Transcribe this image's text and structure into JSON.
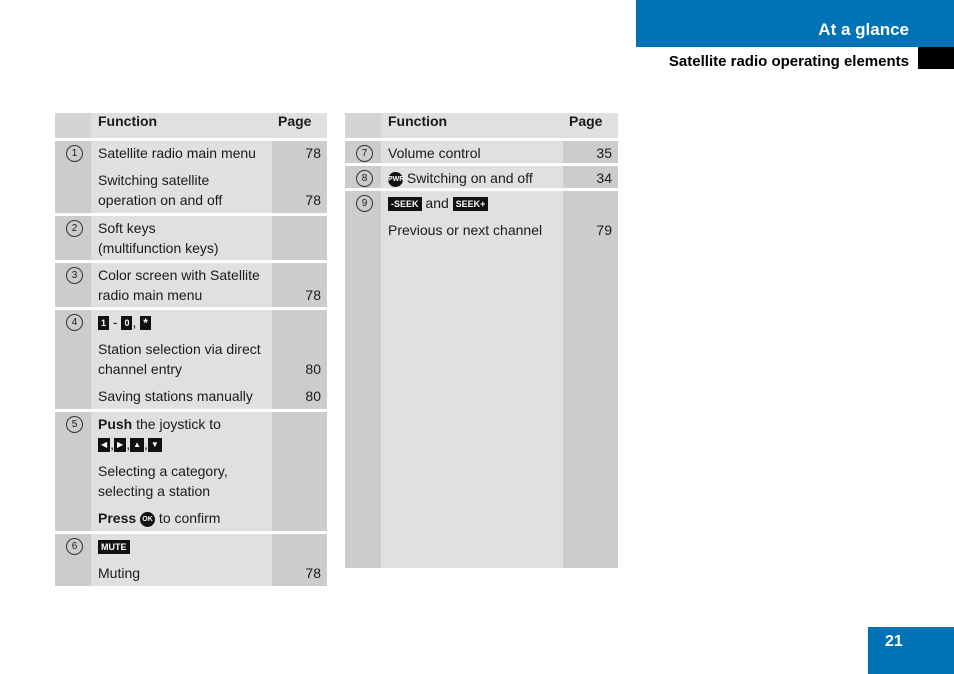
{
  "header": {
    "section": "At a glance",
    "subsection": "Satellite radio operating elements"
  },
  "page_number": "21",
  "colors": {
    "brand_blue": "#0073b7",
    "header_cell": "#e0e0e0",
    "side_cell": "#cccccc"
  },
  "left_table": {
    "headers": {
      "function": "Function",
      "page": "Page"
    },
    "rows": [
      {
        "num": "1",
        "lines": [
          {
            "text": "Satellite radio main menu",
            "page": "78"
          },
          {
            "text": "Switching satellite",
            "page": ""
          },
          {
            "text": "operation on and off",
            "page": "78"
          }
        ]
      },
      {
        "num": "2",
        "lines": [
          {
            "text": "Soft keys",
            "page": ""
          },
          {
            "text": "(multifunction keys)",
            "page": ""
          }
        ]
      },
      {
        "num": "3",
        "lines": [
          {
            "text": "Color screen with Satellite",
            "page": ""
          },
          {
            "text": "radio main menu",
            "page": "78"
          }
        ]
      },
      {
        "num": "4",
        "keys": {
          "k1": "1",
          "sep1": "-",
          "k2": "0",
          "sep2": ",",
          "k3": "*"
        },
        "lines": [
          {
            "text": "Station selection via direct",
            "page": ""
          },
          {
            "text": "channel entry",
            "page": "80"
          },
          {
            "text": "Saving stations manually",
            "page": "80"
          }
        ]
      },
      {
        "num": "5",
        "push_bold": "Push",
        "push_rest": " the joystick to",
        "arrows": {
          "left": "◀",
          "right": "▶",
          "up": "▲",
          "down": "▼",
          "comma": ","
        },
        "lines": [
          {
            "text": "Selecting a category,",
            "page": ""
          },
          {
            "text": "selecting a station",
            "page": ""
          }
        ],
        "press_bold": "Press",
        "ok_key": "OK",
        "press_rest": " to confirm"
      },
      {
        "num": "6",
        "key": "MUTE",
        "lines": [
          {
            "text": "Muting",
            "page": "78"
          }
        ]
      }
    ]
  },
  "right_table": {
    "headers": {
      "function": "Function",
      "page": "Page"
    },
    "rows": [
      {
        "num": "7",
        "text": "Volume control",
        "page": "35"
      },
      {
        "num": "8",
        "key": "PWR",
        "text": " Switching on and off",
        "page": "34"
      },
      {
        "num": "9",
        "key_minus": "-SEEK",
        "and": " and ",
        "key_plus": "SEEK+",
        "text": "Previous or next channel",
        "page": "79"
      }
    ]
  }
}
